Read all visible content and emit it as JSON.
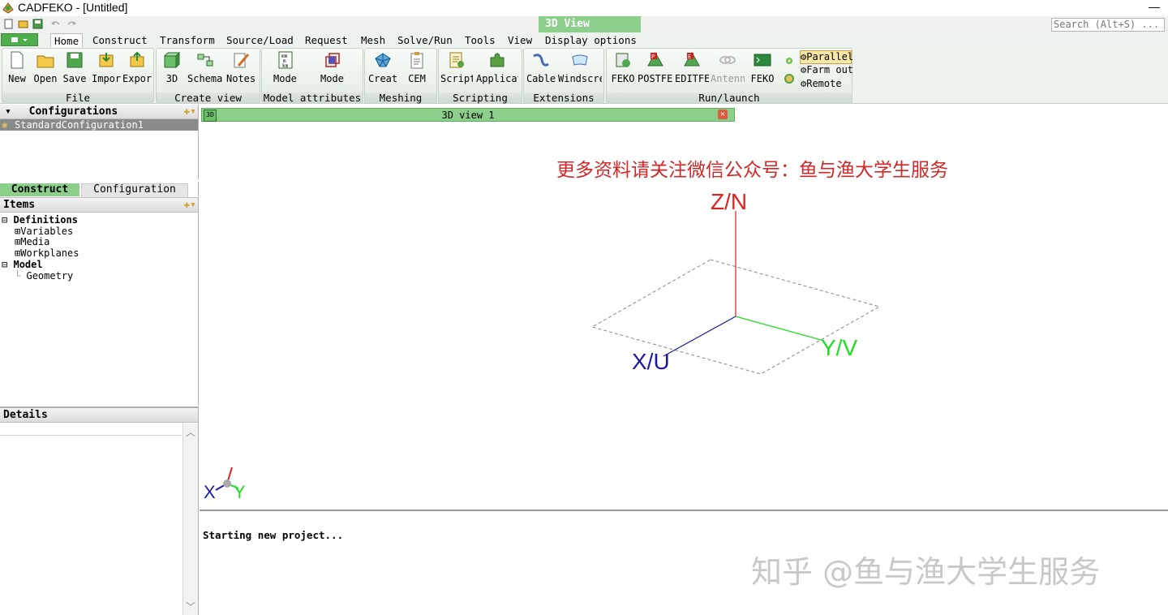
{
  "window": {
    "title": "CADFEKO - [Untitled]",
    "minimize": "—"
  },
  "context_tab": "3D View",
  "search": {
    "placeholder": "Search (Alt+S) ..."
  },
  "menu": [
    "Home",
    "Construct",
    "Transform",
    "Source/Load",
    "Request",
    "Mesh",
    "Solve/Run",
    "Tools",
    "View",
    "Display options"
  ],
  "ribbon": {
    "groups": {
      "file": "File",
      "create_view": "Create view",
      "model_attributes": "Model attributes",
      "meshing": "Meshing",
      "scripting": "Scripting",
      "extensions": "Extensions",
      "run_launch": "Run/launch"
    },
    "buttons": {
      "new": "New",
      "open": "Open",
      "save": "Save",
      "import": "Import",
      "export": "Export",
      "view3d": "3D",
      "schematic": "Schematic",
      "notes": "Notes",
      "model_unit": "Model",
      "model_extents": "Model",
      "create_mesh": "Create",
      "cem_validate": "CEM",
      "script_editor": "Script",
      "app_macros": "Application",
      "cable": "Cable",
      "windscreen": "Windscreen",
      "feko_solver": "FEKO",
      "postfeko": "POSTFEKO",
      "editfeko": "EDITFEKO",
      "antenna": "Antenna",
      "feko_terminal": "FEKO"
    },
    "run_options": [
      "Parallel",
      "Farm out",
      "Remote"
    ]
  },
  "configurations": {
    "header": "Configurations",
    "selected": "StandardConfiguration1"
  },
  "left_tabs": {
    "construct": "Construct",
    "configuration": "Configuration"
  },
  "items": {
    "header": "Items",
    "tree": {
      "definitions": "Definitions",
      "variables": "Variables",
      "media": "Media",
      "workplanes": "Workplanes",
      "model": "Model",
      "geometry": "Geometry"
    }
  },
  "details": {
    "header": "Details"
  },
  "viewport": {
    "tab_title": "3D view 1",
    "watermark_top": "更多资料请关注微信公众号：鱼与渔大学生服务",
    "axis_z": "Z/N",
    "axis_y": "Y/V",
    "axis_x": "X/U",
    "mini_x": "X",
    "mini_y": "Y",
    "colors": {
      "x": "#1a1aa6",
      "y": "#22dd22",
      "z": "#dd2222",
      "tab_green": "#8ccf8a"
    }
  },
  "output": {
    "message": "Starting new project...",
    "watermark": "知乎 @鱼与渔大学生服务"
  }
}
